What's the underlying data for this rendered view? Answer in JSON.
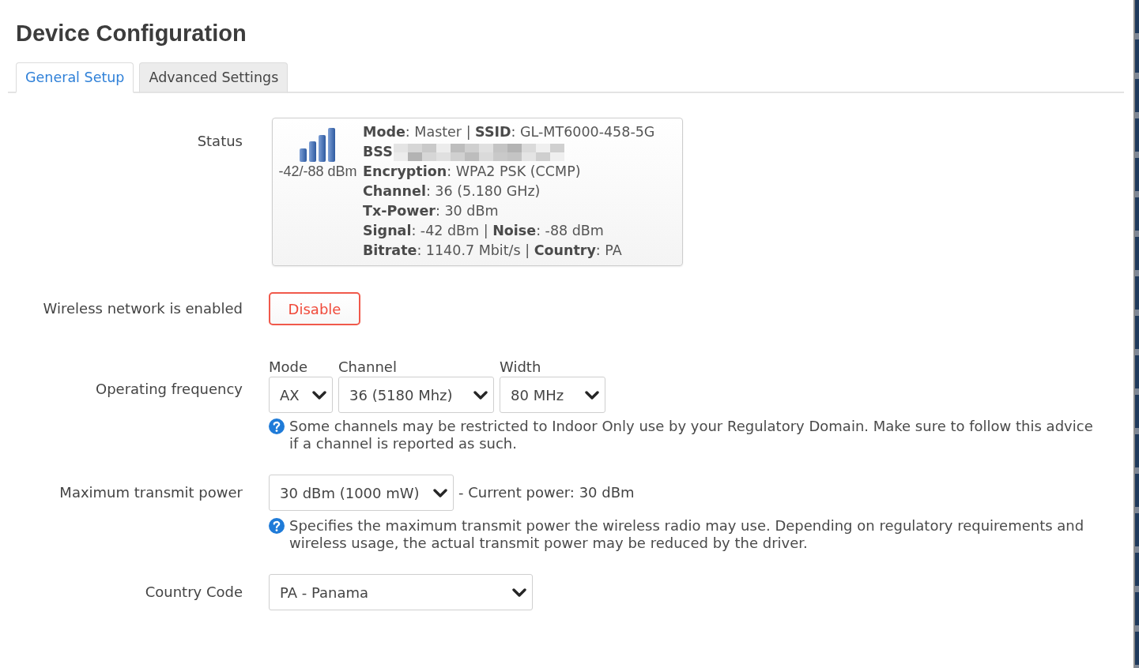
{
  "page_title": "Device Configuration",
  "tabs": [
    {
      "label": "General Setup",
      "selected": true
    },
    {
      "label": "Advanced Settings",
      "selected": false
    }
  ],
  "form": [
    {
      "kind": "status",
      "label": "Status",
      "signal_reading": "-42/-88 dBm",
      "lines": [
        {
          "text": "**Mode**: Master | **SSID**: GL-MT6000-458-5G",
          "redacted": false
        },
        {
          "text": "BSS",
          "redacted": true
        },
        {
          "text": "**Encryption**: WPA2 PSK (CCMP)",
          "redacted": false
        },
        {
          "text": "**Channel**: 36 (5.180 GHz)",
          "redacted": false
        },
        {
          "text": "**Tx-Power**: 30 dBm",
          "redacted": false
        },
        {
          "text": "**Signal**: -42 dBm | **Noise**: -88 dBm",
          "redacted": false
        },
        {
          "text": "**Bitrate**: 1140.7 Mbit/s | **Country**: PA",
          "redacted": false
        }
      ]
    },
    {
      "kind": "button",
      "label": "Wireless network is enabled",
      "button": "Disable"
    },
    {
      "kind": "selects",
      "label": "Operating frequency",
      "selects": [
        {
          "label": "Mode",
          "value": "AX"
        },
        {
          "label": "Channel",
          "value": "36 (5180 Mhz)"
        },
        {
          "label": "Width",
          "value": "80 MHz"
        }
      ],
      "help": "Some channels may be restricted to Indoor Only use by your Regulatory Domain. Make sure to follow this advice if a channel is reported as such."
    },
    {
      "kind": "select",
      "label": "Maximum transmit power",
      "value": "30 dBm (1000 mW)",
      "note": "- Current power: 30 dBm",
      "help": "Specifies the maximum transmit power the wireless radio may use. Depending on regulatory requirements and wireless usage, the actual transmit power may be reduced by the driver."
    },
    {
      "kind": "select",
      "label": "Country Code",
      "value": "PA - Panama"
    }
  ]
}
